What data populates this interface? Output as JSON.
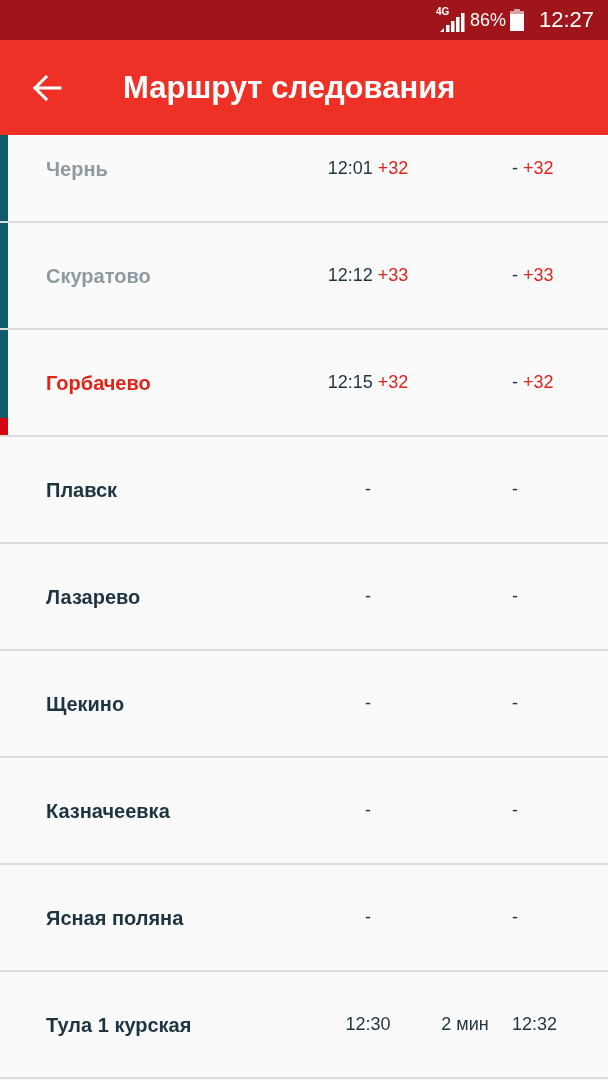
{
  "status_bar": {
    "network": "4G",
    "battery": "86%",
    "time": "12:27"
  },
  "app_bar": {
    "title": "Маршрут следования"
  },
  "stations": [
    {
      "name": "Чернь",
      "kind": "passed",
      "arrival": "12:01",
      "arrival_delay": "+32",
      "departure": "-",
      "departure_delay": "+32"
    },
    {
      "name": "Скуратово",
      "kind": "passed",
      "arrival": "12:12",
      "arrival_delay": "+33",
      "departure": "-",
      "departure_delay": "+33"
    },
    {
      "name": "Горбачево",
      "kind": "current",
      "arrival": "12:15",
      "arrival_delay": "+32",
      "departure": "-",
      "departure_delay": "+32"
    },
    {
      "name": "Плавск",
      "kind": "upcoming",
      "arrival": "-",
      "departure": "-"
    },
    {
      "name": "Лазарево",
      "kind": "upcoming",
      "arrival": "-",
      "departure": "-"
    },
    {
      "name": "Щекино",
      "kind": "upcoming",
      "arrival": "-",
      "departure": "-"
    },
    {
      "name": "Казначеевка",
      "kind": "upcoming",
      "arrival": "-",
      "departure": "-"
    },
    {
      "name": "Ясная поляна",
      "kind": "upcoming",
      "arrival": "-",
      "departure": "-"
    },
    {
      "name": "Тула 1 курская",
      "kind": "upcoming",
      "arrival": "12:30",
      "stop": "2 мин",
      "departure": "12:32"
    }
  ]
}
